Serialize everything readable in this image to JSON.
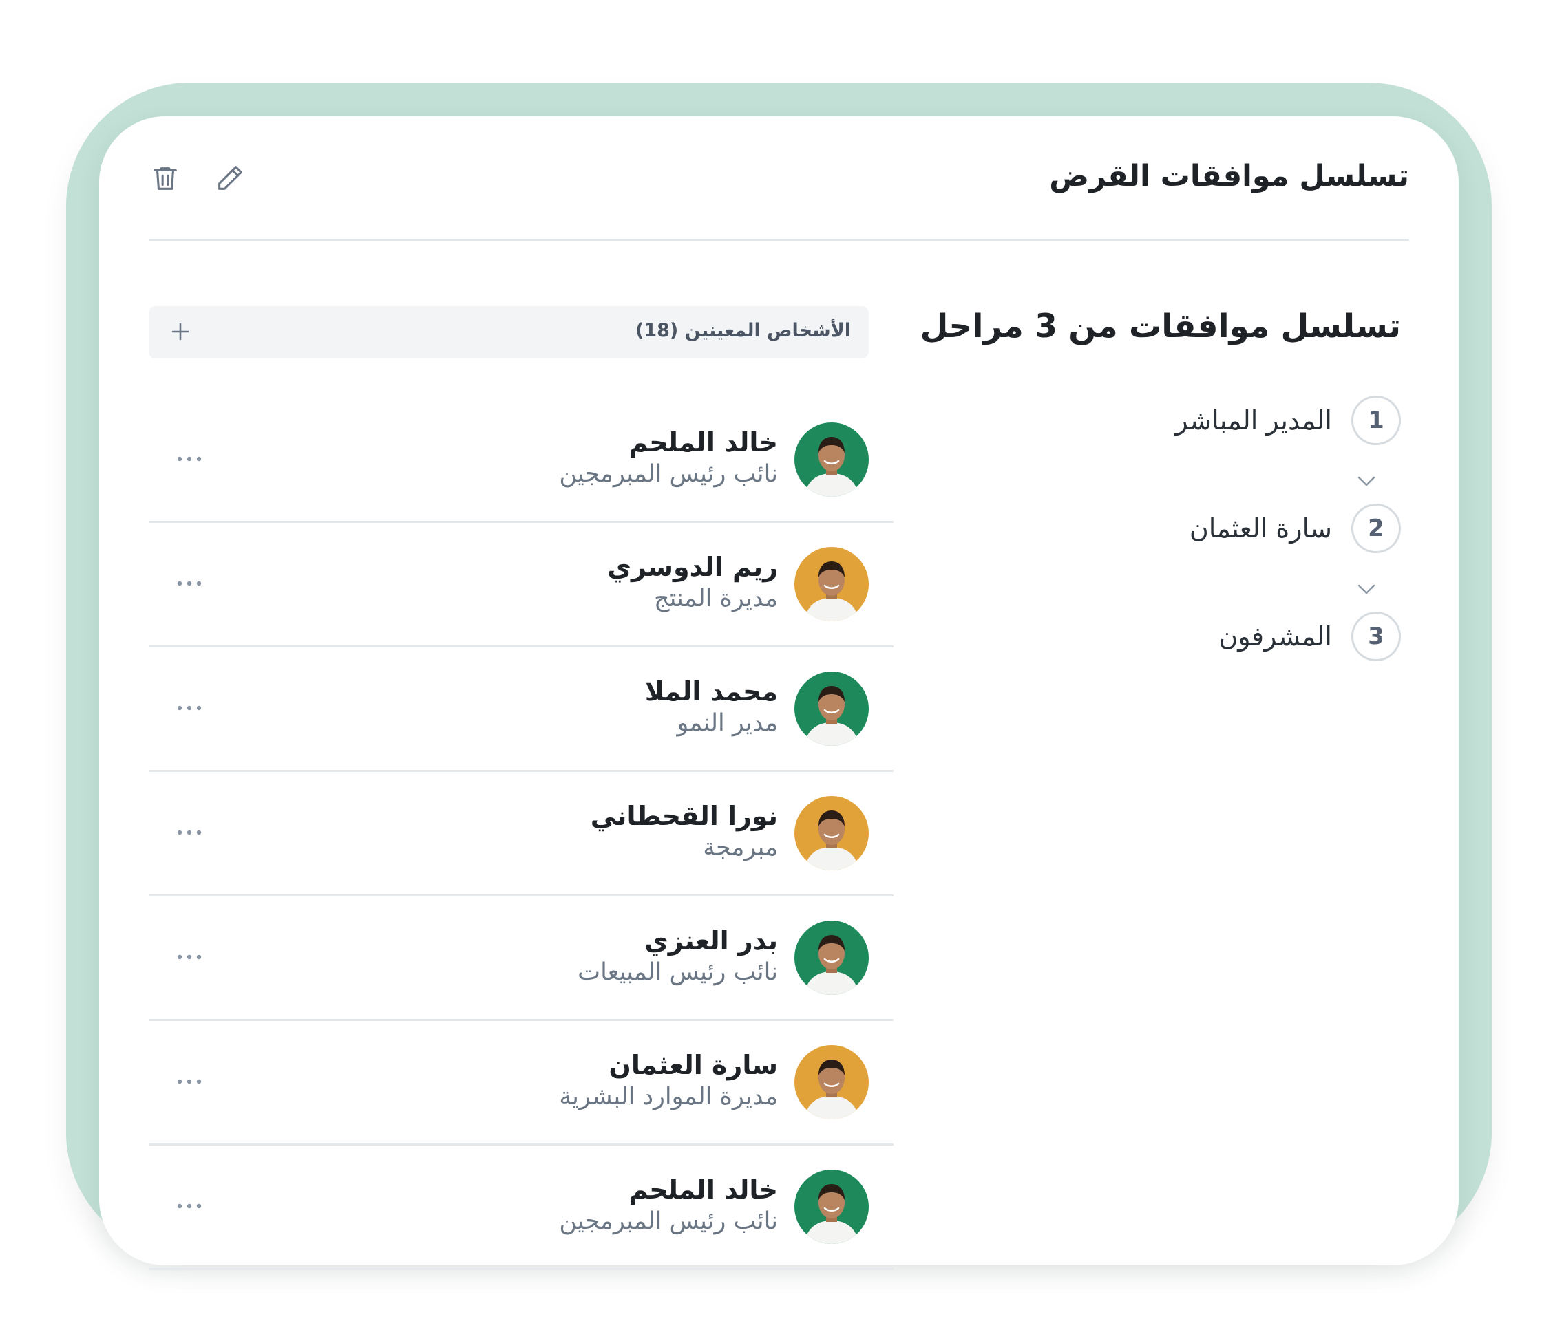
{
  "card": {
    "title": "تسلسل موافقات القرض",
    "actions": [
      {
        "icon": "trash-icon"
      },
      {
        "icon": "pencil-icon"
      }
    ]
  },
  "chain": {
    "title": "تسلسل موافقات من 3 مراحل",
    "steps": [
      {
        "number": "1",
        "label": "المدير المباشر"
      },
      {
        "number": "2",
        "label": "سارة العثمان"
      },
      {
        "number": "3",
        "label": "المشرفون"
      }
    ]
  },
  "people": {
    "title": "الأشخاص المعينين (18)",
    "items": [
      {
        "name": "خالد الملحم",
        "role": "نائب رئيس المبرمجين",
        "avatar_bg": "#1e8a5c"
      },
      {
        "name": "ريم الدوسري",
        "role": "مديرة المنتج",
        "avatar_bg": "#e2a23a"
      },
      {
        "name": "محمد الملا",
        "role": "مدير النمو",
        "avatar_bg": "#1e8a5c"
      },
      {
        "name": "نورا القحطاني",
        "role": "مبرمجة",
        "avatar_bg": "#e2a23a"
      },
      {
        "name": "بدر العنزي",
        "role": "نائب رئيس المبيعات",
        "avatar_bg": "#1e8a5c"
      },
      {
        "name": "سارة العثمان",
        "role": "مديرة الموارد البشرية",
        "avatar_bg": "#e2a23a"
      },
      {
        "name": "خالد الملحم",
        "role": "نائب رئيس المبرمجين",
        "avatar_bg": "#1e8a5c"
      }
    ]
  },
  "colors": {
    "frame": "#c2e0d6",
    "green_avatar": "#1e8a5c",
    "gold_avatar": "#e2a23a"
  }
}
